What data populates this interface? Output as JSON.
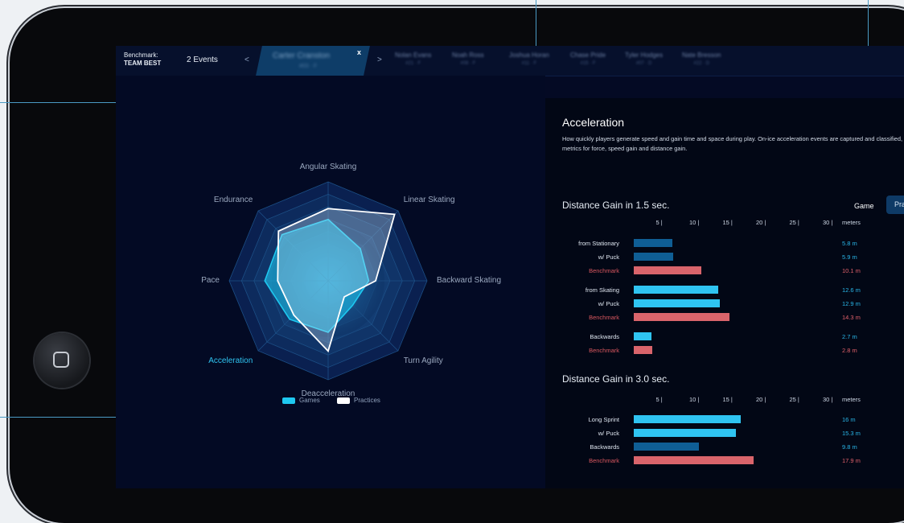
{
  "header": {
    "benchmark_label": "Benchmark:",
    "benchmark_value": "TEAM BEST",
    "events": "2 Events",
    "prev": "<",
    "next": ">",
    "active_tab": {
      "label": "Carter Cranston",
      "sub": "#03 · F",
      "close": "x"
    },
    "tabs": [
      {
        "label": "Nolan Evans",
        "sub": "#21 · F"
      },
      {
        "label": "Noah Ross",
        "sub": "#08 · F"
      },
      {
        "label": "Joshua Horan",
        "sub": "#11 · F"
      },
      {
        "label": "Chase Pride",
        "sub": "#15 · F"
      },
      {
        "label": "Tyler Hodges",
        "sub": "#07 · D"
      },
      {
        "label": "Nate Bresson",
        "sub": "#22 · D"
      }
    ]
  },
  "radar": {
    "axes": [
      "Angular Skating",
      "Linear Skating",
      "Backward Skating",
      "Turn Agility",
      "Deacceleration",
      "Acceleration",
      "Pace",
      "Endurance"
    ],
    "highlighted_axis": "Acceleration",
    "max": 1,
    "games": [
      0.62,
      0.46,
      0.41,
      0.35,
      0.52,
      0.55,
      0.64,
      0.66
    ],
    "practices": [
      0.73,
      0.95,
      0.48,
      0.23,
      0.71,
      0.49,
      0.51,
      0.71
    ],
    "legend": {
      "games": "Games",
      "practices": "Practices"
    },
    "colors": {
      "games": "#1ec8f0",
      "practices": "#ffffff"
    }
  },
  "detail": {
    "title": "Acceleration",
    "description": "How quickly players generate speed and gain time and space during play. On-ice acceleration events are captured and classified, with metrics for force, speed gain and distance gain.",
    "toggle": {
      "game": "Game",
      "practice": "Pra"
    },
    "ticks": [
      "5 |",
      "10 |",
      "15 |",
      "20 |",
      "25 |",
      "30 |"
    ],
    "unit": "meters",
    "colors": {
      "bright": "#2fc4f1",
      "dark": "#0f5e95",
      "benchmark": "#d9646b"
    },
    "chart1": {
      "title": "Distance Gain in 1.5 sec.",
      "rows": [
        {
          "label": "from Stationary",
          "value": 5.8,
          "display": "5.8 m",
          "kind": "dark"
        },
        {
          "label": "w/ Puck",
          "value": 5.9,
          "display": "5.9 m",
          "kind": "dark"
        },
        {
          "label": "Benchmark",
          "value": 10.1,
          "display": "10.1 m",
          "kind": "benchmark"
        },
        {
          "label": "from Skating",
          "value": 12.6,
          "display": "12.6 m",
          "kind": "bright"
        },
        {
          "label": "w/ Puck",
          "value": 12.9,
          "display": "12.9 m",
          "kind": "bright"
        },
        {
          "label": "Benchmark",
          "value": 14.3,
          "display": "14.3 m",
          "kind": "benchmark"
        },
        {
          "label": "Backwards",
          "value": 2.7,
          "display": "2.7 m",
          "kind": "bright"
        },
        {
          "label": "Benchmark",
          "value": 2.8,
          "display": "2.8 m",
          "kind": "benchmark"
        }
      ]
    },
    "chart2": {
      "title": "Distance Gain in 3.0 sec.",
      "rows": [
        {
          "label": "Long Sprint",
          "value": 16,
          "display": "16 m",
          "kind": "bright"
        },
        {
          "label": "w/ Puck",
          "value": 15.3,
          "display": "15.3 m",
          "kind": "bright"
        },
        {
          "label": "Backwards",
          "value": 9.8,
          "display": "9.8 m",
          "kind": "dark"
        },
        {
          "label": "Benchmark",
          "value": 17.9,
          "display": "17.9 m",
          "kind": "benchmark"
        }
      ]
    }
  }
}
